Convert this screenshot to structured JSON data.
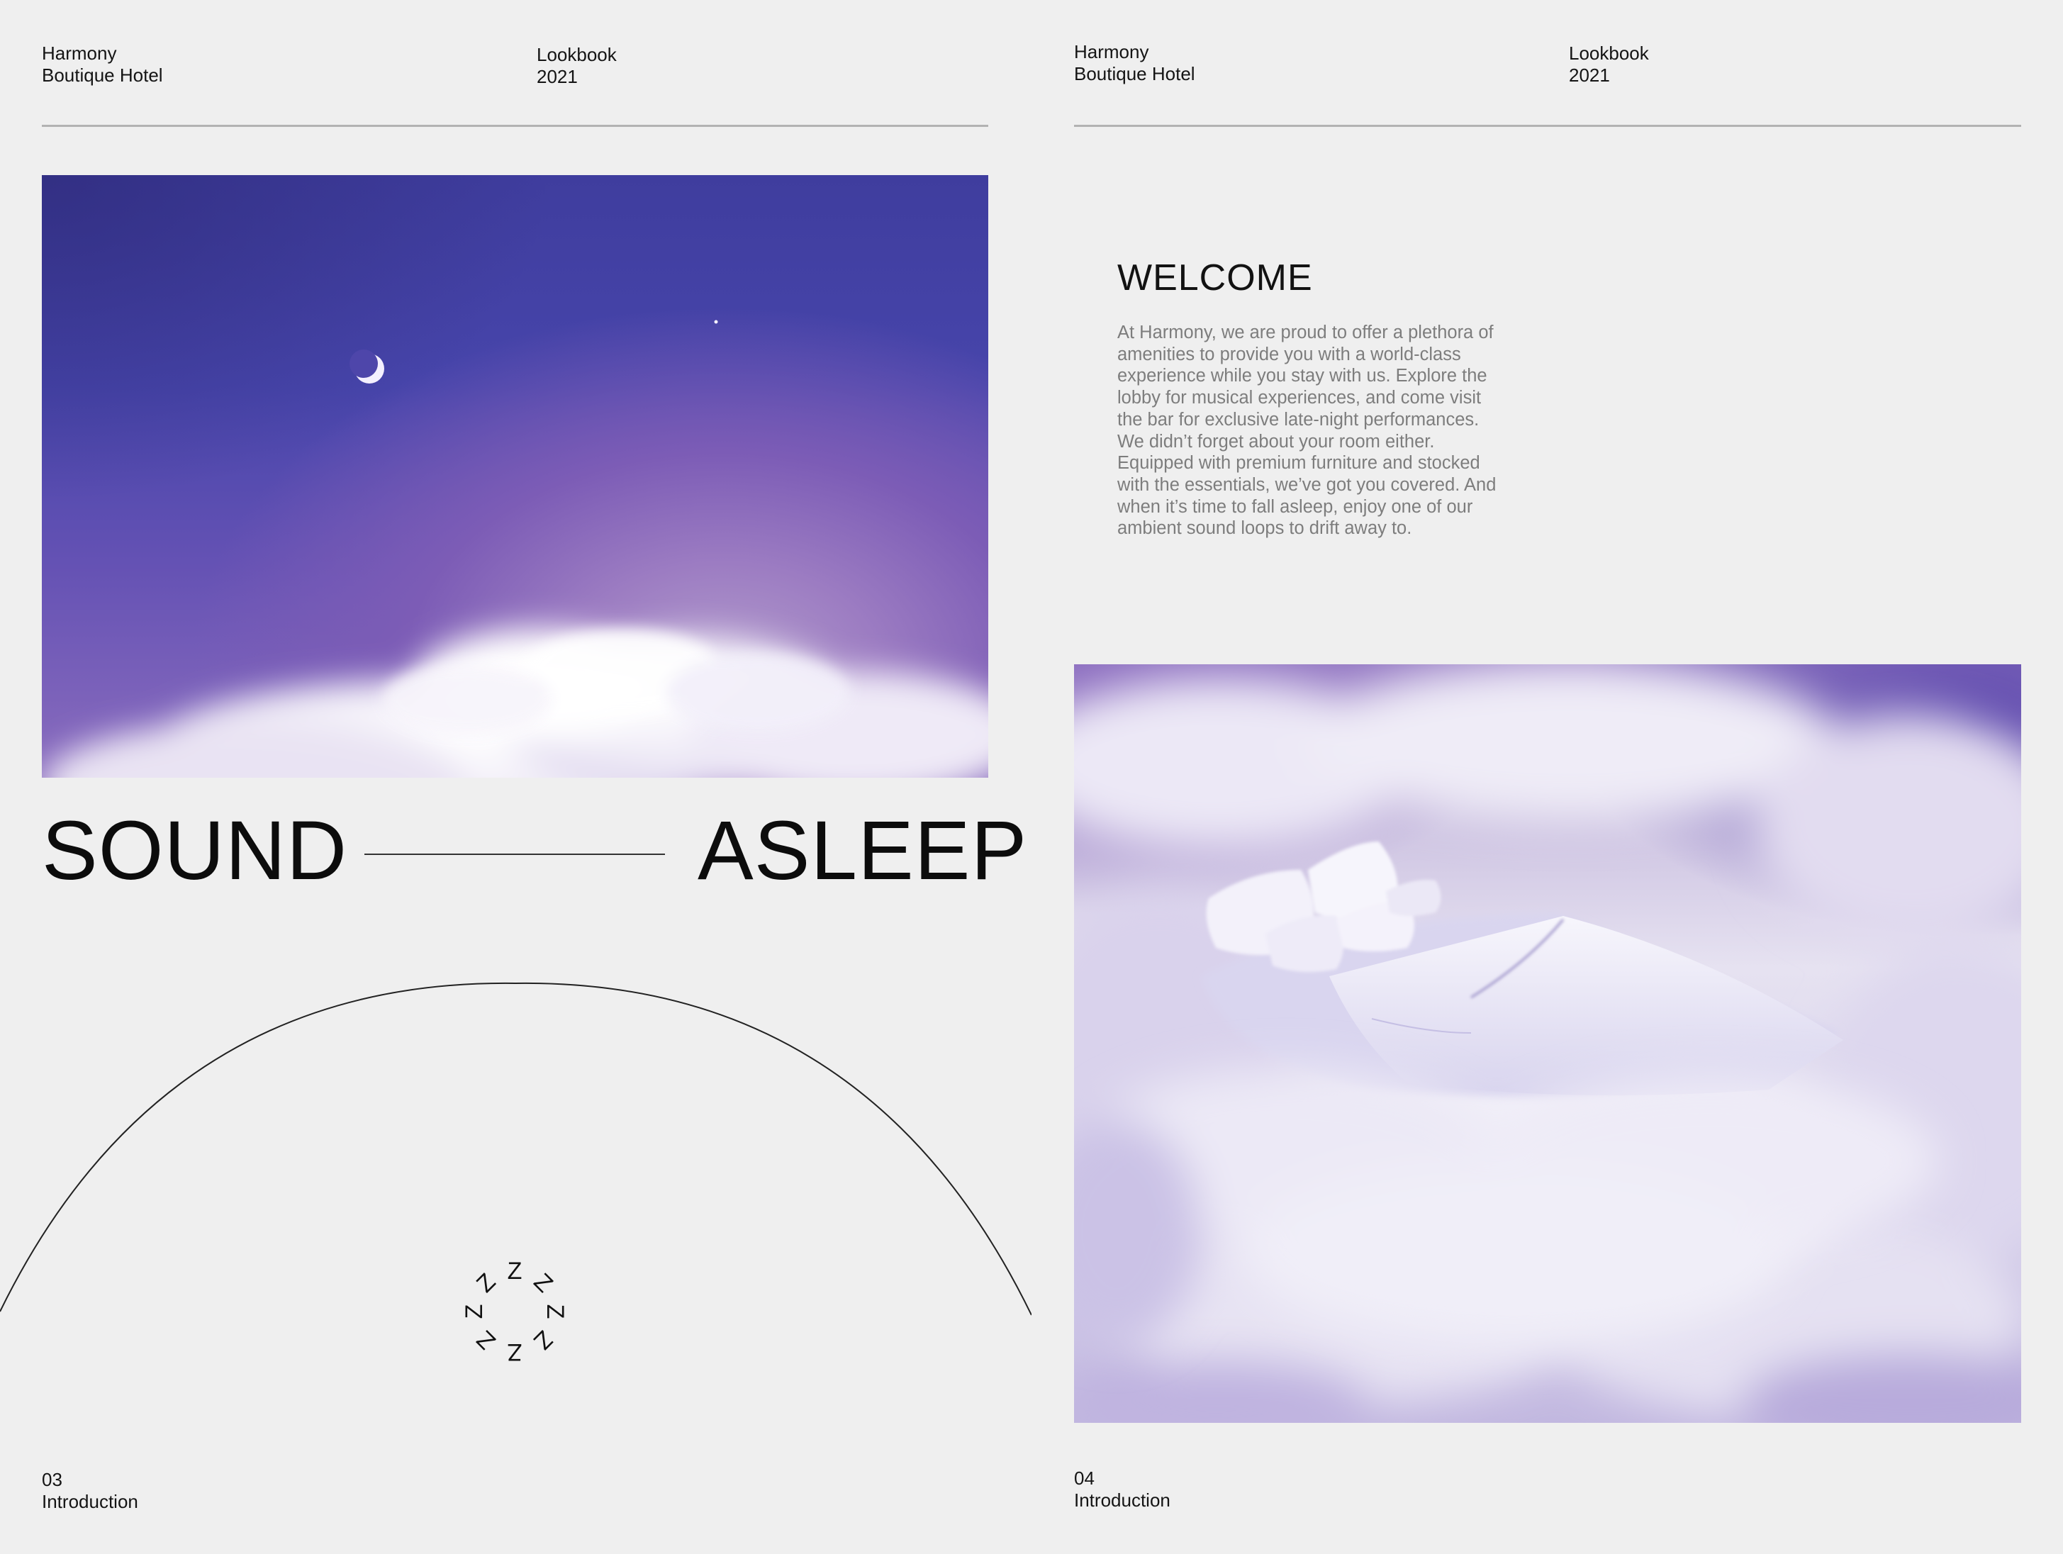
{
  "left_page": {
    "header": {
      "brand_line1": "Harmony",
      "brand_line2": "Boutique Hotel",
      "doc_line1": "Lookbook",
      "doc_line2": "2021"
    },
    "title": {
      "word1": "SOUND",
      "word2": "ASLEEP"
    },
    "sleep_icon_glyph": "Z",
    "footer": {
      "page_number": "03",
      "section": "Introduction"
    }
  },
  "right_page": {
    "header": {
      "brand_line1": "Harmony",
      "brand_line2": "Boutique Hotel",
      "doc_line1": "Lookbook",
      "doc_line2": "2021"
    },
    "welcome": {
      "title": "WELCOME",
      "body_lines": [
        "At Harmony, we are proud to offer a plethora of",
        "amenities to provide you with a world-class",
        "experience while you stay with us. Explore the",
        "lobby for musical experiences, and come visit",
        "the bar for exclusive late-night performances.",
        "We didn’t forget about your room either.",
        "Equipped with premium furniture and stocked",
        "with the essentials, we’ve got you covered. And",
        "when it’s time to fall asleep, enjoy one of our",
        "ambient sound loops to drift away to."
      ]
    },
    "footer": {
      "page_number": "04",
      "section": "Introduction"
    }
  },
  "colors": {
    "background": "#efefef",
    "sky_deep": "#4745ab",
    "sky_glow": "#b39ccc",
    "cloud": "#f2f0f8",
    "body_text": "#7d7d7d",
    "rule": "#b2b2b2"
  }
}
